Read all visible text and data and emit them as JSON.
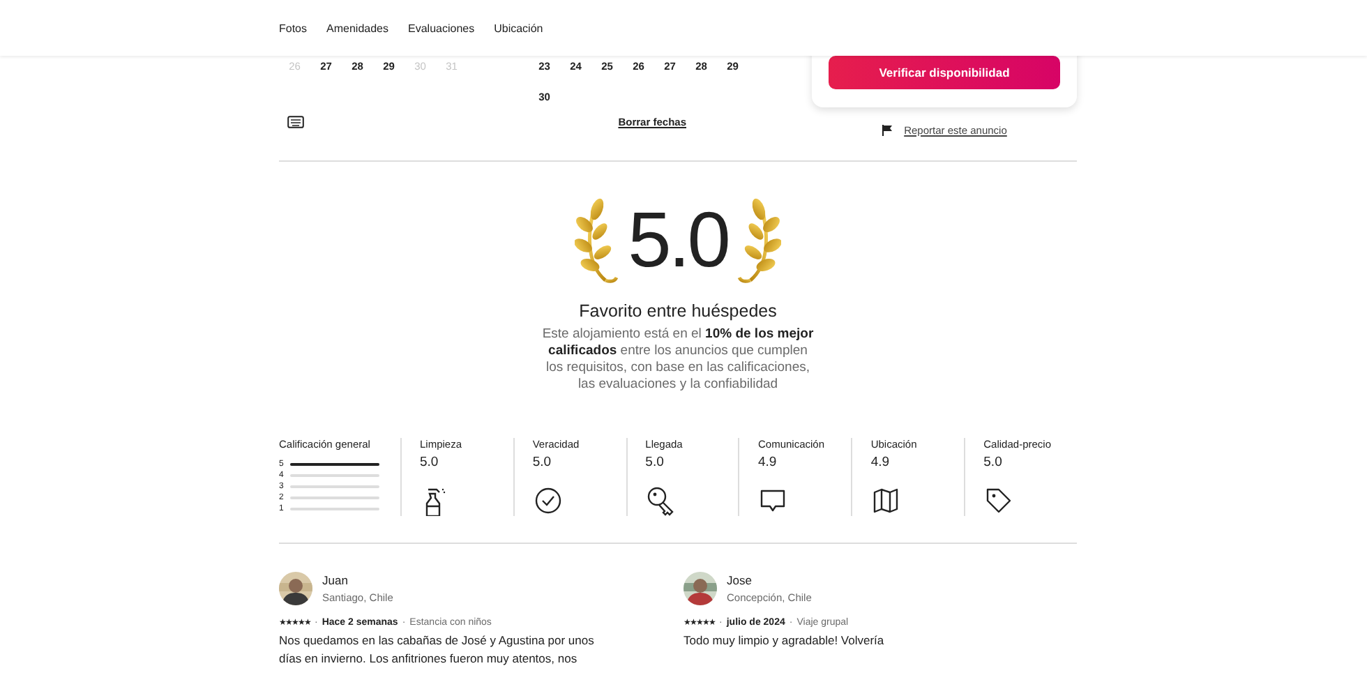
{
  "nav": [
    {
      "label": "Fotos"
    },
    {
      "label": "Amenidades"
    },
    {
      "label": "Evaluaciones"
    },
    {
      "label": "Ubicación"
    }
  ],
  "calendar": {
    "months": [
      {
        "weeks": [
          [
            {
              "day": "26",
              "disabled": true
            },
            {
              "day": "27",
              "disabled": false
            },
            {
              "day": "28",
              "disabled": false
            },
            {
              "day": "29",
              "disabled": false
            },
            {
              "day": "30",
              "disabled": true
            },
            {
              "day": "31",
              "disabled": true
            }
          ]
        ]
      },
      {
        "weeks": [
          [
            {
              "day": "23",
              "disabled": false
            },
            {
              "day": "24",
              "disabled": false
            },
            {
              "day": "25",
              "disabled": false
            },
            {
              "day": "26",
              "disabled": false
            },
            {
              "day": "27",
              "disabled": false
            },
            {
              "day": "28",
              "disabled": false
            },
            {
              "day": "29",
              "disabled": false
            }
          ],
          [
            {
              "day": "30",
              "disabled": false
            }
          ]
        ]
      }
    ],
    "clear_dates": "Borrar fechas"
  },
  "booking": {
    "button": "Verificar disponibilidad",
    "report_link": "Reportar este anuncio"
  },
  "award": {
    "score": "5.0",
    "title": "Favorito entre huéspedes",
    "description": "Este alojamiento está en el **10% de los mejor calificados** entre los anuncios que cumplen los requisitos, con base en las calificaciones, las evaluaciones y la confiabilidad"
  },
  "ratings": {
    "overall": {
      "label": "Calificación general",
      "bars": [
        {
          "label": "5",
          "level": 1
        },
        {
          "label": "4",
          "level": 0
        },
        {
          "label": "3",
          "level": 0
        },
        {
          "label": "2",
          "level": 0
        },
        {
          "label": "1",
          "level": 0
        }
      ]
    },
    "categories": [
      {
        "label": "Limpieza",
        "value": "5.0"
      },
      {
        "label": "Veracidad",
        "value": "5.0"
      },
      {
        "label": "Llegada",
        "value": "5.0"
      },
      {
        "label": "Comunicación",
        "value": "4.9"
      },
      {
        "label": "Ubicación",
        "value": "4.9"
      },
      {
        "label": "Calidad-precio",
        "value": "5.0"
      }
    ]
  },
  "reviews": [
    {
      "name": "Juan",
      "location": "Santiago, Chile",
      "stars": 5,
      "separator": "·",
      "date": "Hace 2 semanas",
      "trip": "Estancia con niños",
      "text": "Nos quedamos en las cabañas de José y Agustina por unos días en invierno. Los anfitriones fueron muy atentos, nos"
    },
    {
      "name": "Jose",
      "location": "Concepción, Chile",
      "stars": 5,
      "separator": "·",
      "date": "julio de 2024",
      "trip": "Viaje grupal",
      "text": "Todo muy limpio y agradable! Volvería"
    }
  ]
}
